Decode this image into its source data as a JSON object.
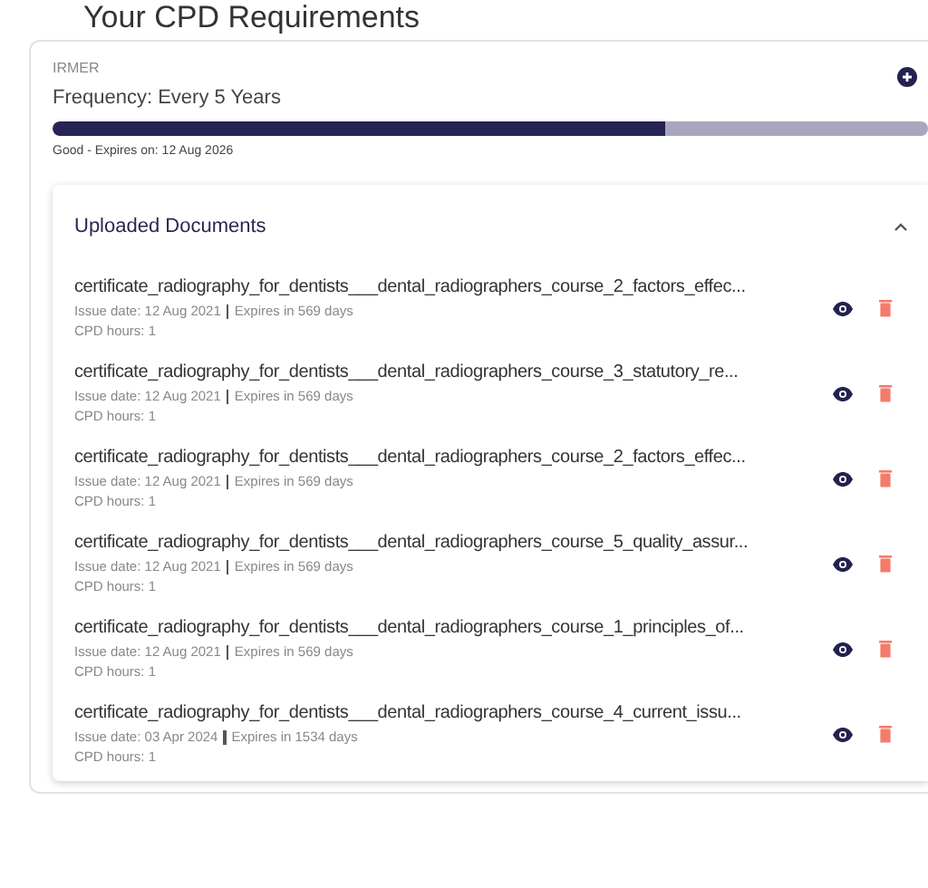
{
  "page_title": "Your CPD Requirements",
  "requirement": {
    "category": "IRMER",
    "frequency": "Frequency: Every 5 Years",
    "level": 0.7,
    "status": "Good - Expires on: 12 Aug 2026"
  },
  "documents": {
    "title": "Uploaded Documents",
    "expanded": true,
    "items": [
      {
        "name": "certificate_radiography_for_dentists___dental_radiographers_course_2_factors_effec...",
        "issue_date": "Issue date: 12 Aug 2021",
        "expires": "Expires in 569 days",
        "cpd_hours": "CPD hours: 1"
      },
      {
        "name": "certificate_radiography_for_dentists___dental_radiographers_course_3_statutory_re...",
        "issue_date": "Issue date: 12 Aug 2021",
        "expires": "Expires in 569 days",
        "cpd_hours": "CPD hours: 1"
      },
      {
        "name": "certificate_radiography_for_dentists___dental_radiographers_course_2_factors_effec...",
        "issue_date": "Issue date: 12 Aug 2021",
        "expires": "Expires in 569 days",
        "cpd_hours": "CPD hours: 1"
      },
      {
        "name": "certificate_radiography_for_dentists___dental_radiographers_course_5_quality_assur...",
        "issue_date": "Issue date: 12 Aug 2021",
        "expires": "Expires in 569 days",
        "cpd_hours": "CPD hours: 1"
      },
      {
        "name": "certificate_radiography_for_dentists___dental_radiographers_course_1_principles_of...",
        "issue_date": "Issue date: 12 Aug 2021",
        "expires": "Expires in 569 days",
        "cpd_hours": "CPD hours: 1"
      },
      {
        "name": "certificate_radiography_for_dentists___dental_radiographers_course_4_current_issu...",
        "issue_date": "Issue date: 03 Apr 2024",
        "expires": "Expires in 1534 days",
        "cpd_hours": "CPD hours: 1"
      }
    ]
  }
}
